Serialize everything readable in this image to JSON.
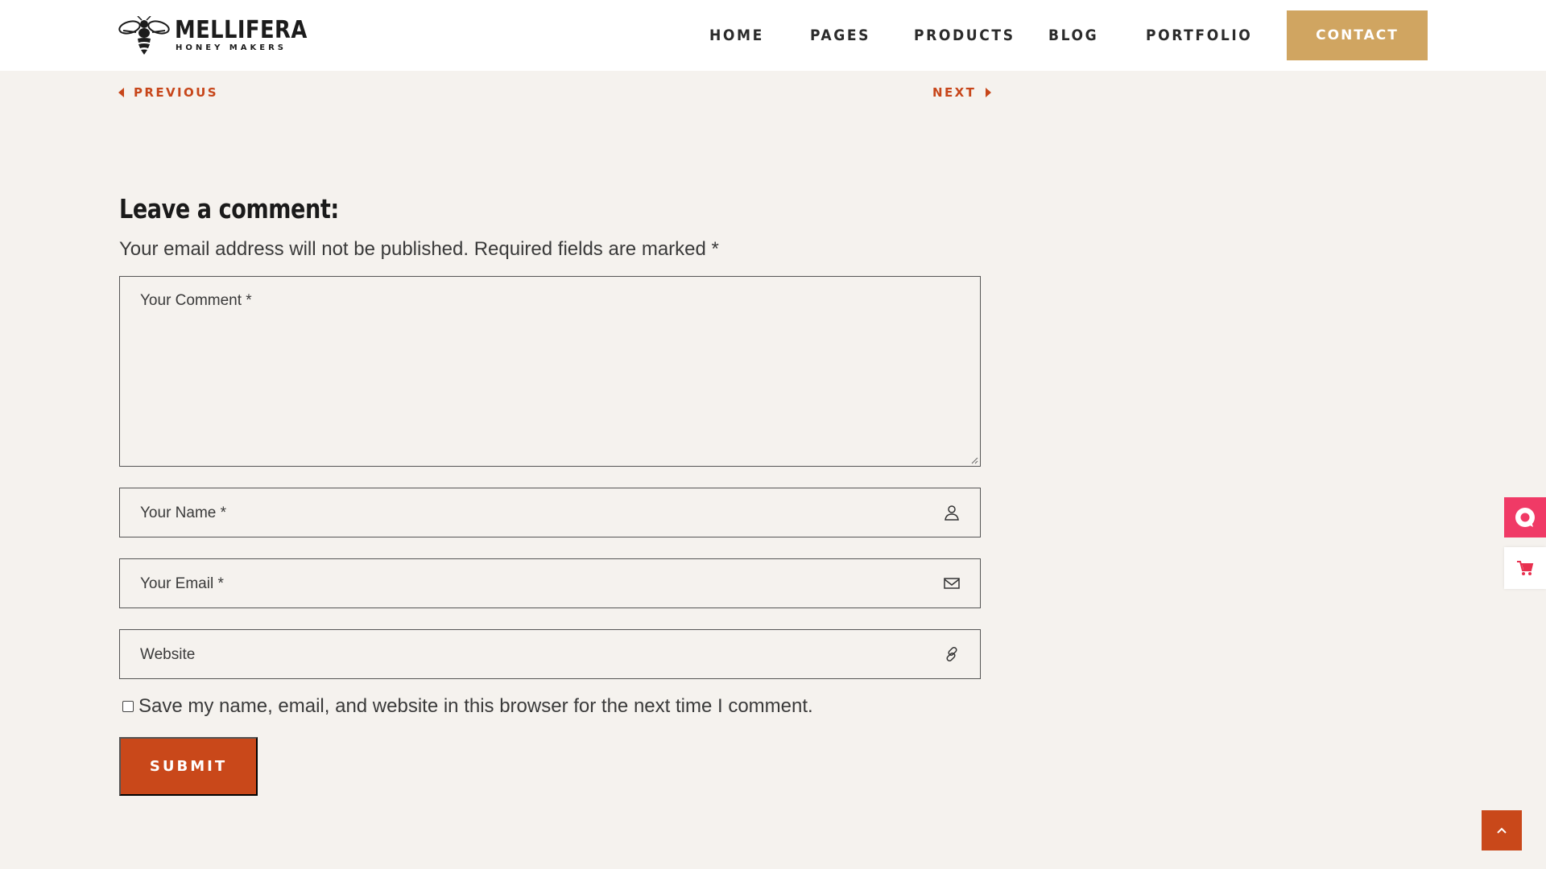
{
  "header": {
    "logo": {
      "title": "MELLIFERA",
      "subtitle": "HONEY MAKERS",
      "icon": "bee-icon"
    },
    "nav": [
      {
        "label": "HOME"
      },
      {
        "label": "PAGES"
      },
      {
        "label": "PRODUCTS"
      },
      {
        "label": "BLOG"
      },
      {
        "label": "PORTFOLIO"
      }
    ],
    "contact_label": "CONTACT"
  },
  "post_nav": {
    "previous_label": "PREVIOUS",
    "next_label": "NEXT"
  },
  "comment_form": {
    "title": "Leave a comment:",
    "note": "Your email address will not be published. Required fields are marked *",
    "comment_placeholder": "Your Comment *",
    "name_placeholder": "Your Name *",
    "email_placeholder": "Your Email *",
    "website_placeholder": "Website",
    "save_label": "Save my name, email, and website in this browser for the next time I comment.",
    "save_checked": false,
    "submit_label": "SUBMIT"
  },
  "colors": {
    "background": "#f5f2ee",
    "accent": "#c9481a",
    "contact_button": "#d0a561",
    "chat_widget": "#f03a66"
  }
}
